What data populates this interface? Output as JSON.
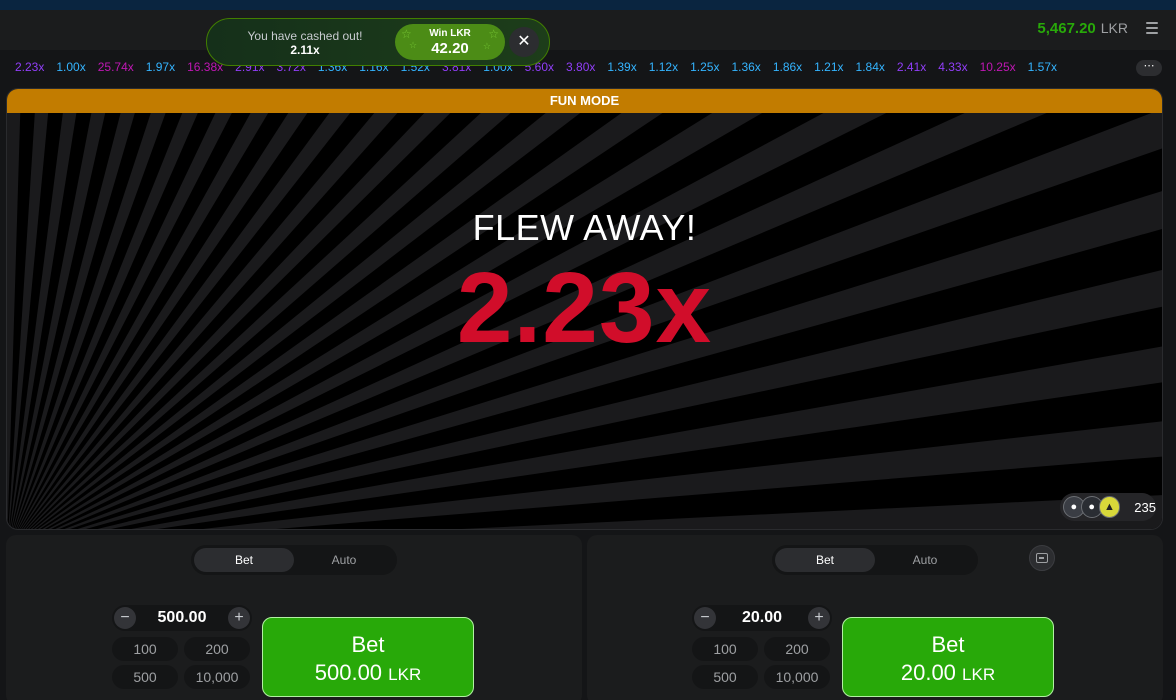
{
  "header": {
    "balance": "5,467.20",
    "currency": "LKR"
  },
  "toast": {
    "message": "You have cashed out!",
    "multiplier": "2.11x",
    "win_label": "Win LKR",
    "win_amount": "42.20",
    "close_icon": "close-icon"
  },
  "history": [
    {
      "value": "2.23x",
      "color": "purple"
    },
    {
      "value": "1.00x",
      "color": "blue"
    },
    {
      "value": "25.74x",
      "color": "pink"
    },
    {
      "value": "1.97x",
      "color": "blue"
    },
    {
      "value": "16.38x",
      "color": "pink"
    },
    {
      "value": "2.91x",
      "color": "purple"
    },
    {
      "value": "3.72x",
      "color": "purple"
    },
    {
      "value": "1.36x",
      "color": "blue"
    },
    {
      "value": "1.16x",
      "color": "blue"
    },
    {
      "value": "1.52x",
      "color": "blue"
    },
    {
      "value": "3.81x",
      "color": "purple"
    },
    {
      "value": "1.00x",
      "color": "blue"
    },
    {
      "value": "5.60x",
      "color": "purple"
    },
    {
      "value": "3.80x",
      "color": "purple"
    },
    {
      "value": "1.39x",
      "color": "blue"
    },
    {
      "value": "1.12x",
      "color": "blue"
    },
    {
      "value": "1.25x",
      "color": "blue"
    },
    {
      "value": "1.36x",
      "color": "blue"
    },
    {
      "value": "1.86x",
      "color": "blue"
    },
    {
      "value": "1.21x",
      "color": "blue"
    },
    {
      "value": "1.84x",
      "color": "blue"
    },
    {
      "value": "2.41x",
      "color": "purple"
    },
    {
      "value": "4.33x",
      "color": "purple"
    },
    {
      "value": "10.25x",
      "color": "pink"
    },
    {
      "value": "1.57x",
      "color": "blue"
    }
  ],
  "history_more": "⋯",
  "stage": {
    "banner": "FUN MODE",
    "status": "FLEW AWAY!",
    "multiplier": "2.23x",
    "players_count": "235"
  },
  "colors": {
    "green": "#28a909",
    "red": "#d10d2a",
    "banner": "#c27c00",
    "blue": "#34b4ff",
    "purple": "#913ef8",
    "pink": "#c017b4"
  },
  "panels": [
    {
      "tabs": [
        "Bet",
        "Auto"
      ],
      "amount": "500.00",
      "minus": "−",
      "plus": "+",
      "quick": [
        "100",
        "200",
        "500",
        "10,000"
      ],
      "bet_label": "Bet",
      "bet_amount": "500.00",
      "bet_currency": "LKR"
    },
    {
      "tabs": [
        "Bet",
        "Auto"
      ],
      "amount": "20.00",
      "minus": "−",
      "plus": "+",
      "quick": [
        "100",
        "200",
        "500",
        "10,000"
      ],
      "bet_label": "Bet",
      "bet_amount": "20.00",
      "bet_currency": "LKR"
    }
  ]
}
